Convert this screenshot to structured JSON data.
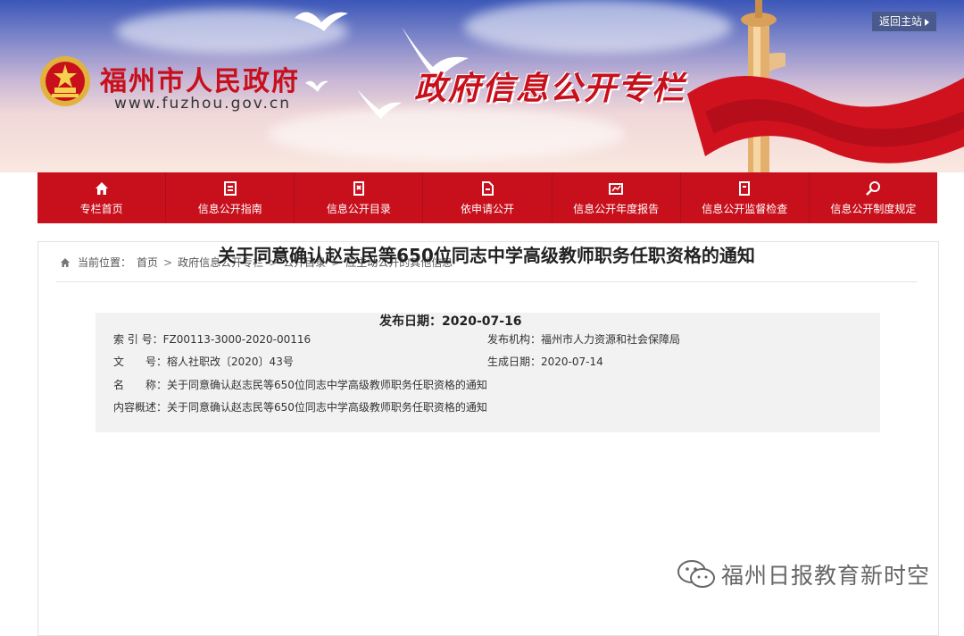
{
  "header": {
    "site_title": "福州市人民政府",
    "site_url": "www.fuzhou.gov.cn",
    "section_title": "政府信息公开专栏",
    "return_label": "返回主站"
  },
  "nav": {
    "items": [
      {
        "label": "专栏首页",
        "icon": "home-icon"
      },
      {
        "label": "信息公开指南",
        "icon": "guide-icon"
      },
      {
        "label": "信息公开目录",
        "icon": "catalog-icon"
      },
      {
        "label": "依申请公开",
        "icon": "apply-icon"
      },
      {
        "label": "信息公开年度报告",
        "icon": "report-icon"
      },
      {
        "label": "信息公开监督检查",
        "icon": "supervision-icon"
      },
      {
        "label": "信息公开制度规定",
        "icon": "search-rules-icon"
      }
    ]
  },
  "breadcrumb": {
    "prefix": "当前位置：",
    "items": [
      "首页",
      "政府信息公开专栏",
      "公开目录",
      "应主动公开的其他信息"
    ],
    "separator": ">"
  },
  "meta": {
    "index_label": "索 引 号：",
    "index_value": "FZ00113-3000-2020-00116",
    "issuer_label": "发布机构：",
    "issuer_value": "福州市人力资源和社会保障局",
    "doc_label": "文　　号：",
    "doc_value": "榕人社职改〔2020〕43号",
    "date_label": "生成日期：",
    "date_value": "2020-07-14",
    "name_label": "名　　称：",
    "name_value": "关于同意确认赵志民等650位同志中学高级教师职务任职资格的通知",
    "summary_label": "内容概述：",
    "summary_value": "关于同意确认赵志民等650位同志中学高级教师职务任职资格的通知"
  },
  "article": {
    "title": "关于同意确认赵志民等650位同志中学高级教师职务任职资格的通知",
    "pub_label": "发布日期：",
    "pub_date": "2020-07-16"
  },
  "watermark": {
    "text": "福州日报教育新时空"
  },
  "colors": {
    "brand_red": "#c8101c",
    "nav_red": "#c8101c",
    "meta_bg": "#f2f2f2"
  }
}
